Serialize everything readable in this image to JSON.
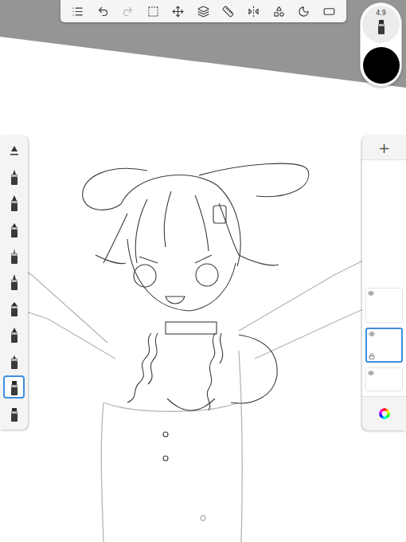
{
  "toolbar": {
    "tools": [
      {
        "disabled": false
      },
      {
        "disabled": false
      },
      {
        "disabled": true
      },
      {
        "disabled": false
      },
      {
        "disabled": false
      },
      {
        "disabled": false
      },
      {
        "disabled": false
      },
      {
        "disabled": false
      },
      {
        "disabled": false
      },
      {
        "disabled": false
      },
      {
        "disabled": false
      }
    ]
  },
  "brush_puck": {
    "size": "4.9",
    "color": "#000000"
  },
  "brushes": [
    {
      "selected": false
    },
    {
      "selected": false
    },
    {
      "selected": false
    },
    {
      "selected": false
    },
    {
      "selected": false
    },
    {
      "selected": false
    },
    {
      "selected": false
    },
    {
      "selected": false
    },
    {
      "selected": true
    },
    {
      "selected": false
    }
  ],
  "layers_panel": {
    "add_button": "+",
    "layers": [
      {
        "visible": true,
        "selected": false,
        "locked": false
      },
      {
        "visible": true,
        "selected": true,
        "locked": true
      },
      {
        "visible": true,
        "selected": false,
        "locked": false
      }
    ]
  }
}
